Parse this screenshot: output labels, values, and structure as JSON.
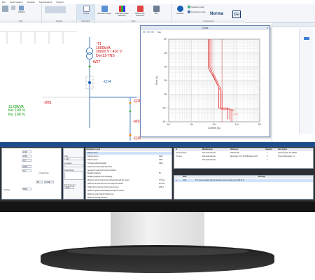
{
  "menu": {
    "items": [
      "File",
      "Insert location",
      "Analysis",
      "Specifications",
      "Support"
    ]
  },
  "ribbon": {
    "groups": [
      "Edit",
      "Drawing",
      "Calculation",
      "Tools",
      "Configuration"
    ],
    "buttons": {
      "drawing": "Drawing",
      "curves": "Curves",
      "automatic_design": "Automatic design",
      "automatic_phase_balancing": "Automatic phase balancing",
      "refresh_elements": "Refresh the references",
      "bim": "BIM",
      "locations": "Locations",
      "operating_mode": "Operating mode",
      "component_mode": "Component mode"
    },
    "norma": "Norma",
    "cei": "CEI"
  },
  "diagram": {
    "transformer": {
      "id": "-T1",
      "power": "1600kVA",
      "voltage": "20000 V / 410 V",
      "vector": "Dyn11-TNS"
    },
    "cable_w27": "-W27",
    "breaker_q14": "-Q14",
    "breaker_q15": "-Q15",
    "cable_w28": "-W28",
    "breaker_q16": "-Q16",
    "board": {
      "id": "-DB1",
      "power": "11.09kVA",
      "ke": "Ke: 100 %",
      "ks": "Ks: 100 %"
    },
    "bg_label": "R1"
  },
  "curve_window": {
    "title": "Curve",
    "legend_label": "Plot",
    "xlabel": "Current (A)",
    "ylabel": "Time (s)",
    "marker_q14": "-Q14",
    "marker_q15": "-Q15"
  },
  "chart_data": {
    "type": "line",
    "title": "",
    "xlabel": "Current (A)",
    "ylabel": "Time (s)",
    "x_scale": "log",
    "y_scale": "log",
    "xlim": [
      10,
      100000
    ],
    "ylim": [
      0.01,
      10000
    ],
    "x_ticks": [
      "10¹",
      "10²",
      "10³",
      "10⁴",
      "10⁵"
    ],
    "y_ticks": [
      "10⁴",
      "10³",
      "10²",
      "10¹",
      "10⁰",
      "10⁻¹",
      "10⁻²"
    ],
    "series": [
      {
        "name": "-Q14",
        "x": [
          550,
          550,
          600,
          900,
          1600,
          1600,
          4000,
          4000
        ],
        "y": [
          10000,
          100,
          60,
          20,
          3,
          0.1,
          0.1,
          0.015
        ]
      },
      {
        "name": "-Q15",
        "x": [
          700,
          700,
          800,
          1100,
          2000,
          2000,
          5500,
          5500
        ],
        "y": [
          10000,
          80,
          40,
          12,
          1.5,
          0.08,
          0.08,
          0.01
        ]
      }
    ],
    "grid": true
  },
  "properties": {
    "fields": [
      {
        "label": "",
        "value": "1600"
      },
      {
        "label": "",
        "value": "1250"
      },
      {
        "label": "",
        "value": "0.5"
      },
      {
        "label": "",
        "value": "2000"
      },
      {
        "label": "",
        "value": "0.2"
      },
      {
        "label": "Setting",
        "value": "5600"
      }
    ],
    "checkbox_label": "Selective",
    "tags": [
      "Pv",
      "F+Sel"
    ]
  },
  "title_panel": {
    "fields": [
      {
        "label": "Title",
        "value": "Q14"
      },
      {
        "label": "Location",
        "value": ""
      },
      {
        "label": "Description",
        "value": ""
      },
      {
        "label": "Environment",
        "value": ""
      },
      {
        "label": "",
        "value": "IP20"
      }
    ]
  },
  "calc_panel": {
    "header": "Calculation result",
    "rows": [
      {
        "name": "Rated current",
        "value": ""
      },
      {
        "name": "Design current",
        "value": "1600"
      },
      {
        "name": "Rated current",
        "value": "1600"
      },
      {
        "name": "Thermal setting threshold",
        "value": "1600"
      },
      {
        "name": "Neutral thermal setting threshold",
        "value": ""
      },
      {
        "name": "Selectivity under short-circuit condition",
        "value": ""
      },
      {
        "name": "Breaking capacity",
        "value": "65"
      },
      {
        "name": "Breaking capacity with cascading",
        "value": ""
      },
      {
        "name": "Maximum short-circuit current flowing through the device",
        "value": "37.5 kA"
      },
      {
        "name": "Minimum short-circuit current through the device",
        "value": "22.0 kA"
      },
      {
        "name": "Origin of the minimum short-circuit current",
        "value": "APE-1"
      },
      {
        "name": "Maximum ground fault flowing through the device",
        "value": ""
      },
      {
        "name": "Maximum ground-fault tripping time",
        "value": ""
      },
      {
        "name": "Maximum setting tolerance",
        "value": ""
      }
    ]
  },
  "ref_table": {
    "headers": [
      "Id",
      "Manufacturer",
      "Reference",
      "Quantity",
      "Description"
    ],
    "rows": [
      {
        "id": "Circuit breaker",
        "mfr": "Schneider Electric",
        "ref": "NT16H1 4P",
        "qty": "1",
        "desc": "Circuit breaker NT 1600A"
      },
      {
        "id": "Trip unit",
        "mfr": "Schneider Electric",
        "ref": "Micrologic 7.0 P 4P 3600 Fixed Conf",
        "qty": "1",
        "desc": "Trip unit Micrologic 7.0"
      },
      {
        "id": "",
        "mfr": "Schneider Electric",
        "ref": "",
        "qty": "1",
        "desc": ""
      }
    ]
  },
  "messages": {
    "headers": [
      "Mark",
      "Message"
    ],
    "rows": [
      {
        "mark": "-Q14",
        "msg": "The source located directly upstream can provide up to 2231.07 A"
      }
    ]
  }
}
